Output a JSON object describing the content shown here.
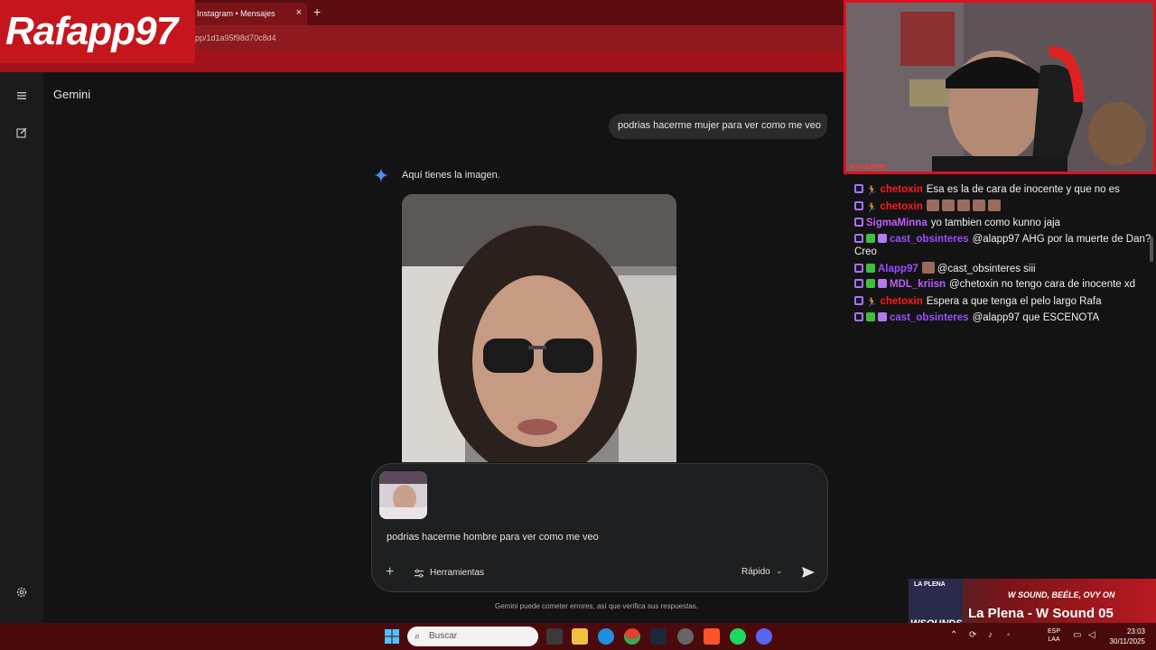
{
  "browser": {
    "tab_title": "Instagram • Mensajes",
    "tab_close": "×",
    "new_tab": "+",
    "url": "pp/1d1a95f98d70c8d4"
  },
  "overlay": {
    "logo": "Rafapp97",
    "cam_name": "RAFAPP97"
  },
  "sidebar": {
    "menu_icon": "hamburger-icon",
    "new_chat_icon": "edit-icon",
    "settings_icon": "gear-icon"
  },
  "app": {
    "title": "Gemini",
    "user_message": "podrias hacerme mujer para ver como me veo",
    "reply_text": "Aquí tienes la imagen.",
    "composer": {
      "prompt_value": "podrias hacerme hombre para ver como me veo",
      "add": "+",
      "tools_label": "Herramientas",
      "mode_label": "Rápido",
      "mode_chevron": "⌄"
    },
    "disclaimer": "Gemini puede cometer errores, así que verifica sus respuestas."
  },
  "chat": {
    "messages": [
      {
        "user": "chetoxin",
        "color": "#ff1a1a",
        "badges": [
          "purple",
          "run"
        ],
        "text": "Esa es la de cara de inocente y que no es",
        "emotes": 0
      },
      {
        "user": "chetoxin",
        "color": "#ff1a1a",
        "badges": [
          "purple",
          "run"
        ],
        "text": "",
        "emotes": 5
      },
      {
        "user": "SigmaMinna",
        "color": "#c05cff",
        "badges": [
          "purple"
        ],
        "text": "yo tambien como kunno jaja",
        "emotes": 0
      },
      {
        "user": "cast_obsinteres",
        "color": "#9b4dff",
        "badges": [
          "purple",
          "green",
          "gift"
        ],
        "text": "@alapp97 AHG por la muerte de Dan? Creo",
        "emotes": 0
      },
      {
        "user": "Alapp97",
        "color": "#9b4dff",
        "badges": [
          "purple",
          "green"
        ],
        "text": "@cast_obsinteres siii",
        "emotes": 1
      },
      {
        "user": "MDL_kriisn",
        "color": "#c05cff",
        "badges": [
          "purple",
          "green",
          "gift"
        ],
        "text": "@chetoxin no tengo cara de inocente xd",
        "emotes": 0
      },
      {
        "user": "chetoxin",
        "color": "#ff1a1a",
        "badges": [
          "purple",
          "run"
        ],
        "text": "Espera a que tenga el pelo largo Rafa",
        "emotes": 0
      },
      {
        "user": "cast_obsinteres",
        "color": "#9b4dff",
        "badges": [
          "purple",
          "green",
          "gift"
        ],
        "text": "@alapp97 que ESCENOTA",
        "emotes": 0
      }
    ]
  },
  "now_playing": {
    "tag": "LA PLENA",
    "art_label": "WSOUNDS",
    "subtitle": "W SOUND, BEÉLE, OVY ON",
    "title": "La Plena - W Sound 05"
  },
  "taskbar": {
    "search_placeholder": "Buscar",
    "language": "ESP",
    "layout": "LAA",
    "time": "23:03",
    "date": "30/11/2025"
  },
  "colors": {
    "brand_red": "#c5161e",
    "gemini_bg": "#131314",
    "bubble": "#2a2b2d"
  }
}
